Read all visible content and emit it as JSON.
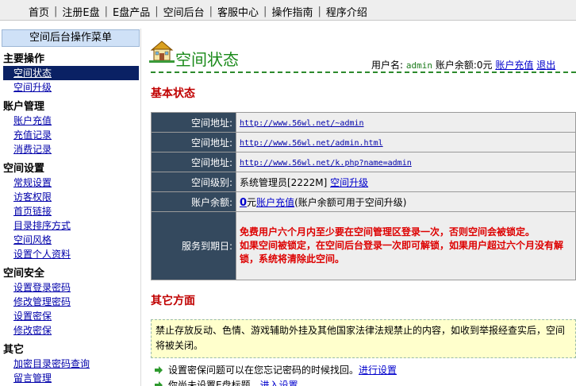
{
  "topnav": {
    "items": [
      "首页",
      "注册E盘",
      "E盘产品",
      "空间后台",
      "客服中心",
      "操作指南",
      "程序介绍"
    ]
  },
  "sidebar": {
    "title": "空间后台操作菜单",
    "groups": [
      {
        "head": "主要操作",
        "items": [
          "空间状态",
          "空间升级"
        ]
      },
      {
        "head": "账户管理",
        "items": [
          "账户充值",
          "充值记录",
          "消费记录"
        ]
      },
      {
        "head": "空间设置",
        "items": [
          "常规设置",
          "访客权限",
          "首页链接",
          "目录排序方式",
          "空间风格",
          "设置个人资料"
        ]
      },
      {
        "head": "空间安全",
        "items": [
          "设置登录密码",
          "修改管理密码",
          "设置密保",
          "修改密保"
        ]
      },
      {
        "head": "其它",
        "items": [
          "加密目录密码查询",
          "留言管理"
        ]
      }
    ]
  },
  "header": {
    "title": "空间状态",
    "user_label": "用户名:",
    "username": "admin",
    "balance_label": "账户余额:",
    "balance": "0元",
    "recharge_link": "账户充值",
    "logout_link": "退出"
  },
  "basic": {
    "heading": "基本状态",
    "rows": {
      "addr1_label": "空间地址:",
      "addr1": "http://www.56wl.net/~admin",
      "addr2_label": "空间地址:",
      "addr2": "http://www.56wl.net/admin.html",
      "addr3_label": "空间地址:",
      "addr3": "http://www.56wl.net/k.php?name=admin",
      "level_label": "空间级别:",
      "level": "系统管理员[2222M]",
      "upgrade_link": "空间升级",
      "balance_label": "账户余额:",
      "balance_num": "0",
      "balance_unit": "元",
      "balance_recharge": "账户充值",
      "balance_note": "(账户余额可用于空间升级)",
      "expiry_label": "服务到期日:",
      "warning1": "免费用户六个月内至少要在空间管理区登录一次，否则空间会被锁定。",
      "warning2": "如果空间被锁定，在空间后台登录一次即可解锁，如果用户超过六个月没有解锁，系统将清除此空间。"
    }
  },
  "other": {
    "heading": "其它方面",
    "notice": "禁止存放反动、色情、游戏辅助外挂及其他国家法律法规禁止的内容，如收到举报经查实后，空间将被关闭。",
    "bullet1_text": "设置密保问题可以在您忘记密码的时候找回。",
    "bullet1_link": "进行设置",
    "bullet2_text": "你尚未设置E盘标题，",
    "bullet2_link": "进入设置"
  },
  "colors": {
    "title_green": "#1a8a1a",
    "heading_red": "#c00000",
    "label_bg": "#34495e",
    "notice_bg": "#ffffcc"
  }
}
